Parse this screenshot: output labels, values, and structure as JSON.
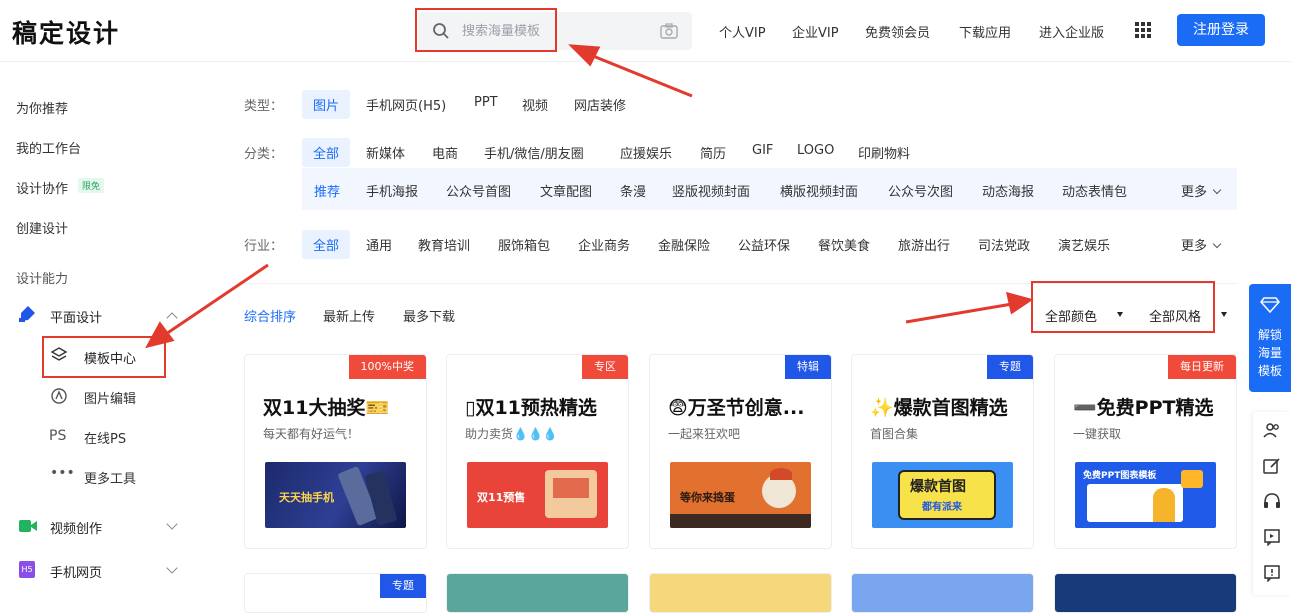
{
  "header": {
    "logo": "稿定设计",
    "search_placeholder": "搜索海量模板",
    "nav": [
      "个人VIP",
      "企业VIP",
      "免费领会员",
      "下载应用",
      "进入企业版"
    ],
    "login_label": "注册登录"
  },
  "sidebar": {
    "top_items": [
      "为你推荐",
      "我的工作台",
      "设计协作",
      "创建设计"
    ],
    "collab_badge": "限免",
    "section_title": "设计能力",
    "group_graphic": "平面设计",
    "sub_items": [
      "模板中心",
      "图片编辑",
      "在线PS",
      "更多工具"
    ],
    "group_video": "视频创作",
    "group_h5": "手机网页",
    "ps_icon_text": "PS",
    "h5_icon_text": "H5"
  },
  "filters": {
    "type_label": "类型：",
    "types": [
      "图片",
      "手机网页(H5)",
      "PPT",
      "视频",
      "网店装修"
    ],
    "category_label": "分类：",
    "categories": [
      "全部",
      "新媒体",
      "电商",
      "手机/微信/朋友圈",
      "应援娱乐",
      "简历",
      "GIF",
      "LOGO",
      "印刷物料"
    ],
    "subcategories": [
      "推荐",
      "手机海报",
      "公众号首图",
      "文章配图",
      "条漫",
      "竖版视频封面",
      "横版视频封面",
      "公众号次图",
      "动态海报",
      "动态表情包"
    ],
    "more": "更多",
    "industry_label": "行业：",
    "industries": [
      "全部",
      "通用",
      "教育培训",
      "服饰箱包",
      "企业商务",
      "金融保险",
      "公益环保",
      "餐饮美食",
      "旅游出行",
      "司法党政",
      "演艺娱乐"
    ]
  },
  "sort": {
    "options": [
      "综合排序",
      "最新上传",
      "最多下载"
    ],
    "color_filter": "全部颜色",
    "style_filter": "全部风格"
  },
  "cards": [
    {
      "tag": "100%中奖",
      "title": "双11大抽奖🎫",
      "subtitle": "每天都有好运气！",
      "thumb_text": "天天抽手机",
      "tag_color": "#f04a3b"
    },
    {
      "tag": "专区",
      "title": "▯双11预热精选",
      "subtitle": "助力卖货💧💧💧",
      "thumb_text": "双11预售",
      "tag_color": "#f04a3b"
    },
    {
      "tag": "特辑",
      "title": "😨万圣节创意...",
      "subtitle": "一起来狂欢吧",
      "thumb_text": "等你来捣蛋",
      "tag_color": "#2157e8"
    },
    {
      "tag": "专题",
      "title": "✨爆款首图精选",
      "subtitle": "首图合集",
      "thumb_text": "爆款首图",
      "thumb_text2": "都有派来",
      "tag_color": "#2157e8"
    },
    {
      "tag": "每日更新",
      "title": "➖免费PPT精选",
      "subtitle": "一键获取",
      "thumb_text": "免费PPT图表模板",
      "tag_color": "#f04a3b"
    }
  ],
  "second_row_tag": "专题",
  "float": {
    "main": [
      "解锁",
      "海量",
      "模板"
    ]
  }
}
